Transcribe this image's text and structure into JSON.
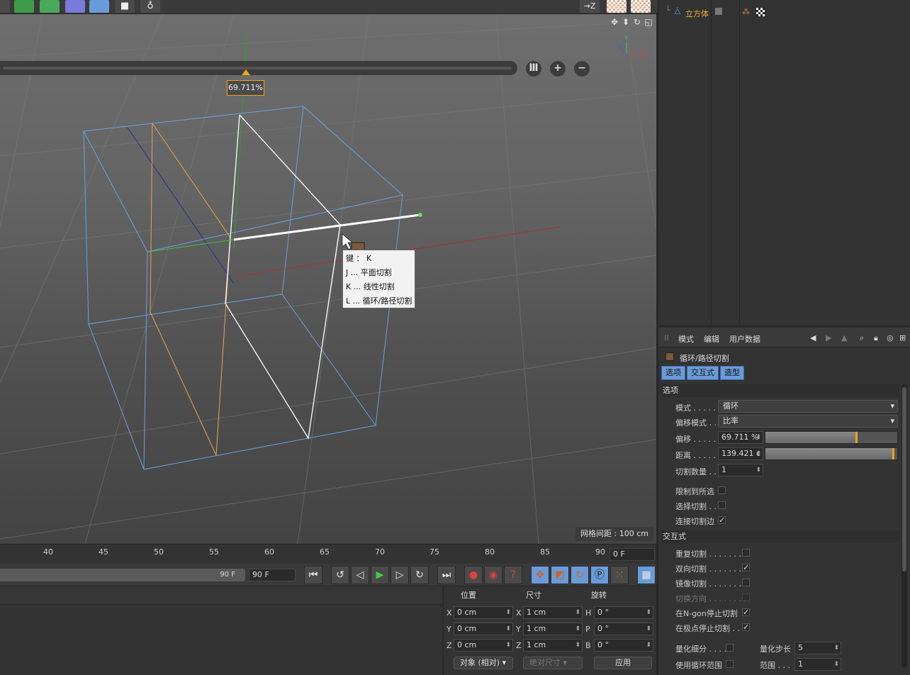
{
  "window": {
    "width": 1284,
    "height": 952
  },
  "colors": {
    "accent_orange": "#f0a020",
    "selection_blue": "#6a9bd8",
    "object_name": "#f0b030"
  },
  "top_toolbar": {
    "right_icon": "→Z"
  },
  "viewport": {
    "nav_icons": [
      "move-view-icon",
      "zoom-view-icon",
      "rotate-view-icon",
      "maximize-view-icon"
    ],
    "offset_readout": "69.711%",
    "grid_spacing": "网格间距 : 100 cm",
    "tooltip": {
      "lines": [
        "键 ： K",
        "J ... 平面切割",
        "K ... 线性切割",
        "L ... 循环/路径切割"
      ]
    },
    "slider_buttons": [
      "Ⅲ",
      "+",
      "−"
    ]
  },
  "timeline": {
    "ticks": [
      "40",
      "45",
      "50",
      "55",
      "60",
      "65",
      "70",
      "75",
      "80",
      "85",
      "90"
    ],
    "current_frame": "0 F",
    "range_end_label": "90 F",
    "end_frame": "90 F"
  },
  "coordinates": {
    "headers": {
      "position": "位置",
      "size": "尺寸",
      "rotation": "旋转"
    },
    "rows": [
      {
        "axis": "X",
        "pos": "0 cm",
        "size_axis": "X",
        "size": "1 cm",
        "rot_axis": "H",
        "rot": "0 °"
      },
      {
        "axis": "Y",
        "pos": "0 cm",
        "size_axis": "Y",
        "size": "1 cm",
        "rot_axis": "P",
        "rot": "0 °"
      },
      {
        "axis": "Z",
        "pos": "0 cm",
        "size_axis": "Z",
        "size": "1 cm",
        "rot_axis": "B",
        "rot": "0 °"
      }
    ],
    "mode_dropdown": "对象 (相对)",
    "size_dropdown": "绝对尺寸",
    "apply_button": "应用"
  },
  "object_manager": {
    "objects": [
      {
        "name": "立方体"
      }
    ]
  },
  "attribute_manager": {
    "menu": {
      "mode": "模式",
      "edit": "编辑",
      "user_data": "用户数据"
    },
    "title": "循环/路径切割",
    "tabs": [
      "选项",
      "交互式",
      "造型"
    ],
    "options": {
      "header": "选项",
      "mode_label": "模式 . . . . .",
      "mode_value": "循环",
      "offset_mode_label": "偏移模式 . .",
      "offset_mode_value": "比率",
      "offset_label": "偏移 . . . . .",
      "offset_value": "69.711 %",
      "offset_fraction": 0.69711,
      "distance_label": "距离 . . . . .",
      "distance_value": "139.421 c",
      "distance_fraction": 0.98,
      "cut_count_label": "切割数量 . .",
      "cut_count_value": "1",
      "restrict_label": "限制到所选",
      "select_cuts_label": "选择切割 . .",
      "connect_edges_label": "连接切割边"
    },
    "interactive": {
      "header": "交互式",
      "repeat_cut_label": "重复切割 . . . . . . . .",
      "bidirectional_label": "双向切割 . . . . . . . .",
      "mirror_cut_label": "镜像切割 . . . . . . . .",
      "switch_dir_label": "切换方向 . . . . . . . .",
      "stop_ngon_label": "在N-gon停止切割",
      "stop_pole_label": "在极点停止切割 . .",
      "quantize_label": "量化细分 . . . .",
      "quantize_step_label": "量化步长",
      "quantize_step_value": "5",
      "use_loop_range_label": "使用循环范围",
      "range_label": "范围 . . .",
      "range_value": "1"
    }
  }
}
